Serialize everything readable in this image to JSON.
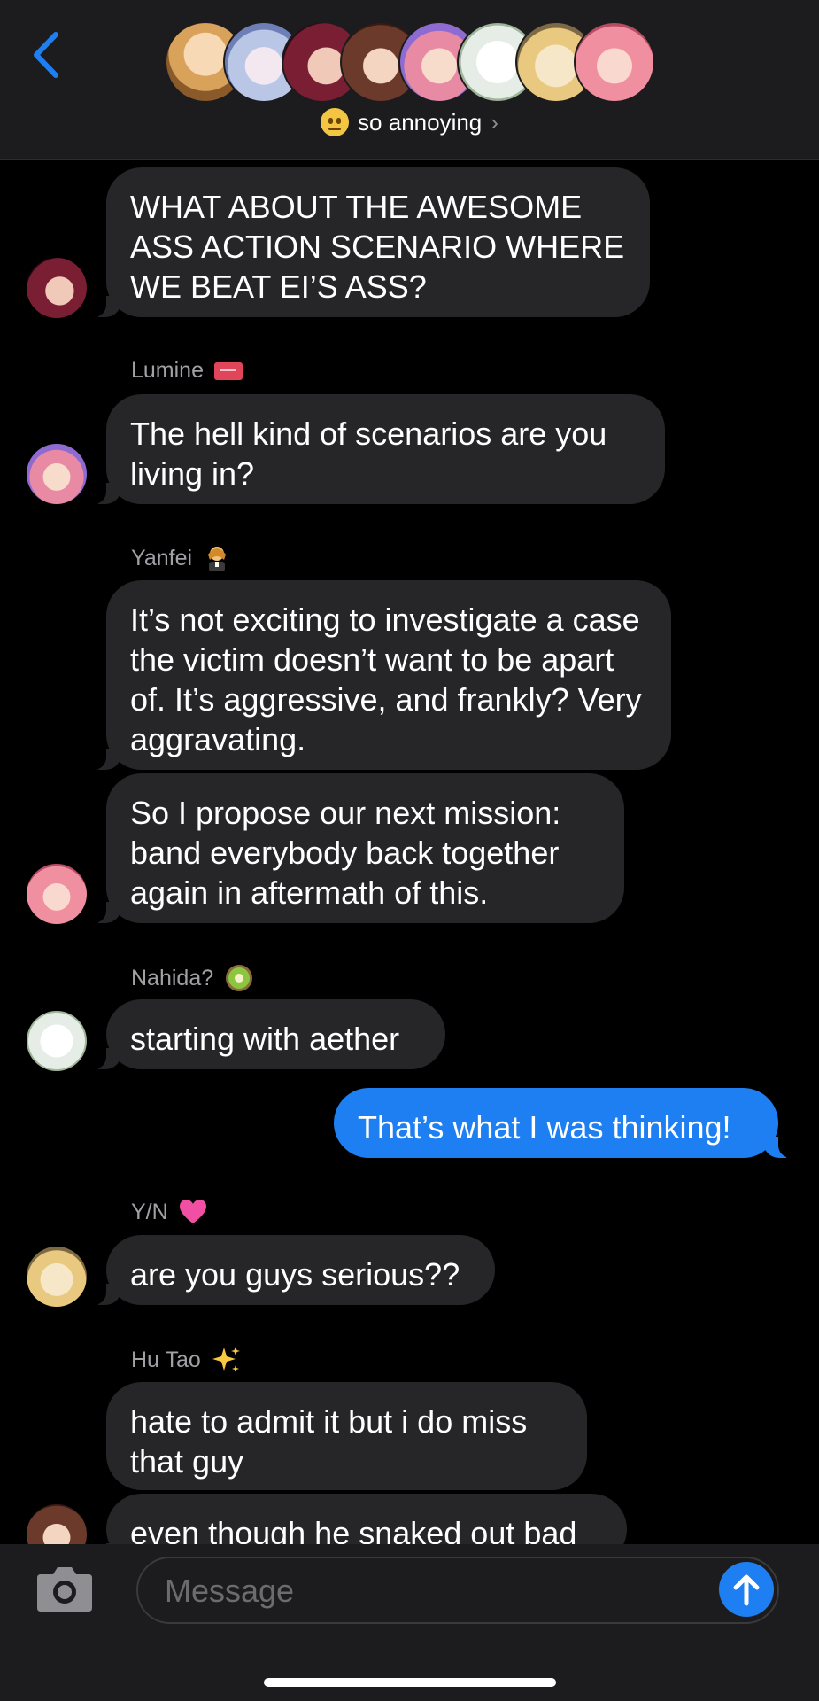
{
  "header": {
    "group_name": "so annoying",
    "group_emoji": "neutral-face",
    "chevron": "›",
    "back_icon": "chevron-left",
    "avatar_count": 8
  },
  "messages": [
    {
      "sender": "",
      "sender_emoji": "",
      "text": "WHAT ABOUT THE AWESOME ASS ACTION SCENARIO WHERE WE BEAT EI’S ASS?"
    },
    {
      "sender": "Lumine",
      "sender_emoji": "admission-ticket",
      "text": "The hell kind of scenarios are you living in?"
    },
    {
      "sender": "Yanfei",
      "sender_emoji": "judge",
      "text": "It’s not exciting to investigate a case the victim doesn’t want to be apart of. It’s aggressive, and frankly? Very aggravating."
    },
    {
      "sender": "",
      "sender_emoji": "",
      "text": "So I propose our next mission: band everybody back together again in aftermath of this."
    },
    {
      "sender": "Nahida?",
      "sender_emoji": "kiwi",
      "text": "starting with aether"
    },
    {
      "sender": "me",
      "sender_emoji": "",
      "text": "That’s what I was thinking!"
    },
    {
      "sender": "Y/N",
      "sender_emoji": "pink-heart",
      "text": "are you guys serious??"
    },
    {
      "sender": "Hu Tao",
      "sender_emoji": "sparkles",
      "text": "hate to admit it but i do miss that guy"
    },
    {
      "sender": "",
      "sender_emoji": "",
      "text": "even though he snaked out bad"
    }
  ],
  "composer": {
    "placeholder": "Message",
    "camera_icon": "camera-icon",
    "send_icon": "arrow-up-icon"
  },
  "colors": {
    "background": "#000000",
    "incoming_bubble": "#262628",
    "outgoing_bubble": "#1d7ff1",
    "accent": "#1d7ff1"
  }
}
